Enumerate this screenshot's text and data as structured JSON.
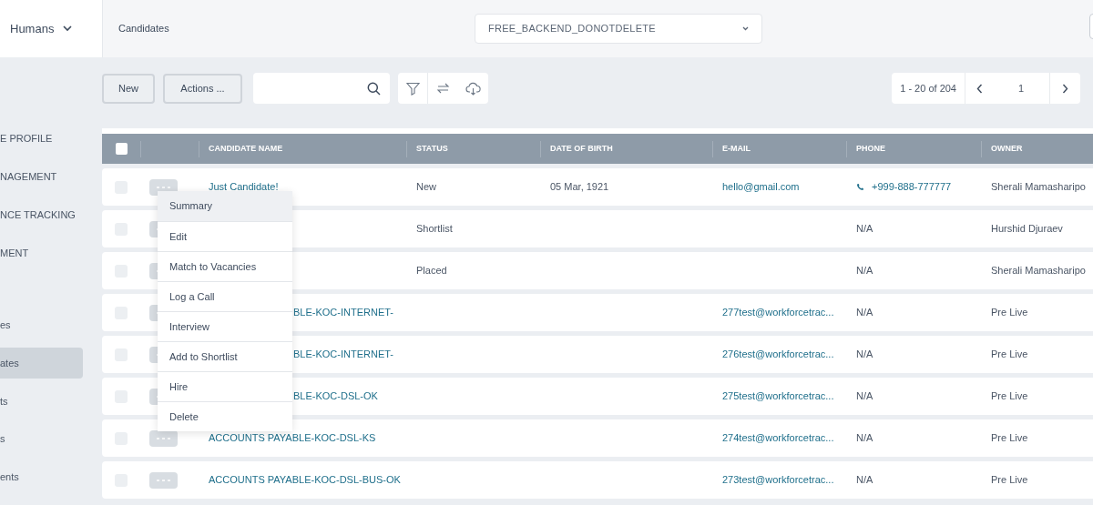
{
  "header": {
    "module": "Humans",
    "page_title": "Candidates",
    "database": "FREE_BACKEND_DONOTDELETE"
  },
  "sidebar": {
    "items": [
      {
        "label": "E PROFILE",
        "selected": false
      },
      {
        "label": "NAGEMENT",
        "selected": false
      },
      {
        "label": "NCE TRACKING",
        "selected": false
      },
      {
        "label": "MENT",
        "selected": false
      },
      {
        "label": "es",
        "selected": false
      },
      {
        "label": "ates",
        "selected": true
      },
      {
        "label": "ts",
        "selected": false
      },
      {
        "label": "s",
        "selected": false
      },
      {
        "label": "ents",
        "selected": false
      }
    ]
  },
  "toolbar": {
    "buttons": [
      "New",
      "Actions ..."
    ],
    "pagination": {
      "range": "1 - 20 of 204",
      "page": "1"
    }
  },
  "table": {
    "select_all_checked": false,
    "columns": [
      "CANDIDATE NAME",
      "STATUS",
      "DATE OF BIRTH",
      "E-MAIL",
      "PHONE",
      "OWNER"
    ],
    "rows": [
      {
        "checked": false,
        "name": "Just Candidate!",
        "status": "New",
        "date_of_birth": "05 Mar, 1921",
        "email": "hello@gmail.com",
        "phone": "+999-888-777777",
        "phone_link": true,
        "owner": "Sherali Mamasharipo"
      },
      {
        "checked": false,
        "status": "Shortlist",
        "date_of_birth": "",
        "email": "",
        "phone": "N/A",
        "phone_link": false,
        "owner": "Hurshid Djuraev"
      },
      {
        "checked": false,
        "status": "Placed",
        "date_of_birth": "",
        "email": "",
        "phone": "N/A",
        "phone_link": false,
        "owner": "Sherali Mamasharipo"
      },
      {
        "name": "BLE-KOC-INTERNET-",
        "name_covered": true,
        "checked": false,
        "status": "",
        "date_of_birth": "",
        "email": "277test@workforcetrac...",
        "phone": "N/A",
        "phone_link": false,
        "owner": "Pre Live"
      },
      {
        "name": "BLE-KOC-INTERNET-",
        "name_covered": true,
        "checked": false,
        "status": "",
        "date_of_birth": "",
        "email": "276test@workforcetrac...",
        "phone": "N/A",
        "phone_link": false,
        "owner": "Pre Live"
      },
      {
        "name": "BLE-KOC-DSL-OK",
        "name_covered": true,
        "checked": false,
        "status": "",
        "date_of_birth": "",
        "email": "275test@workforcetrac...",
        "phone": "N/A",
        "phone_link": false,
        "owner": "Pre Live"
      },
      {
        "name": "ACCOUNTS PAYABLE-KOC-DSL-KS",
        "checked": false,
        "status": "",
        "date_of_birth": "",
        "email": "274test@workforcetrac...",
        "phone": "N/A",
        "phone_link": false,
        "owner": "Pre Live"
      },
      {
        "name": "ACCOUNTS PAYABLE-KOC-DSL-BUS-OK",
        "checked": false,
        "status": "",
        "date_of_birth": "",
        "email": "273test@workforcetrac...",
        "phone": "N/A",
        "phone_link": false,
        "owner": "Pre Live"
      }
    ]
  },
  "context_menu": {
    "items": [
      {
        "label": "Summary",
        "selected": true
      },
      {
        "label": "Edit",
        "selected": false
      },
      {
        "label": "Match to Vacancies",
        "selected": false
      },
      {
        "label": "Log a Call",
        "selected": false
      },
      {
        "label": "Interview",
        "selected": false
      },
      {
        "label": "Add to Shortlist",
        "selected": false
      },
      {
        "label": "Hire",
        "selected": false
      },
      {
        "label": "Delete",
        "selected": false
      }
    ]
  }
}
